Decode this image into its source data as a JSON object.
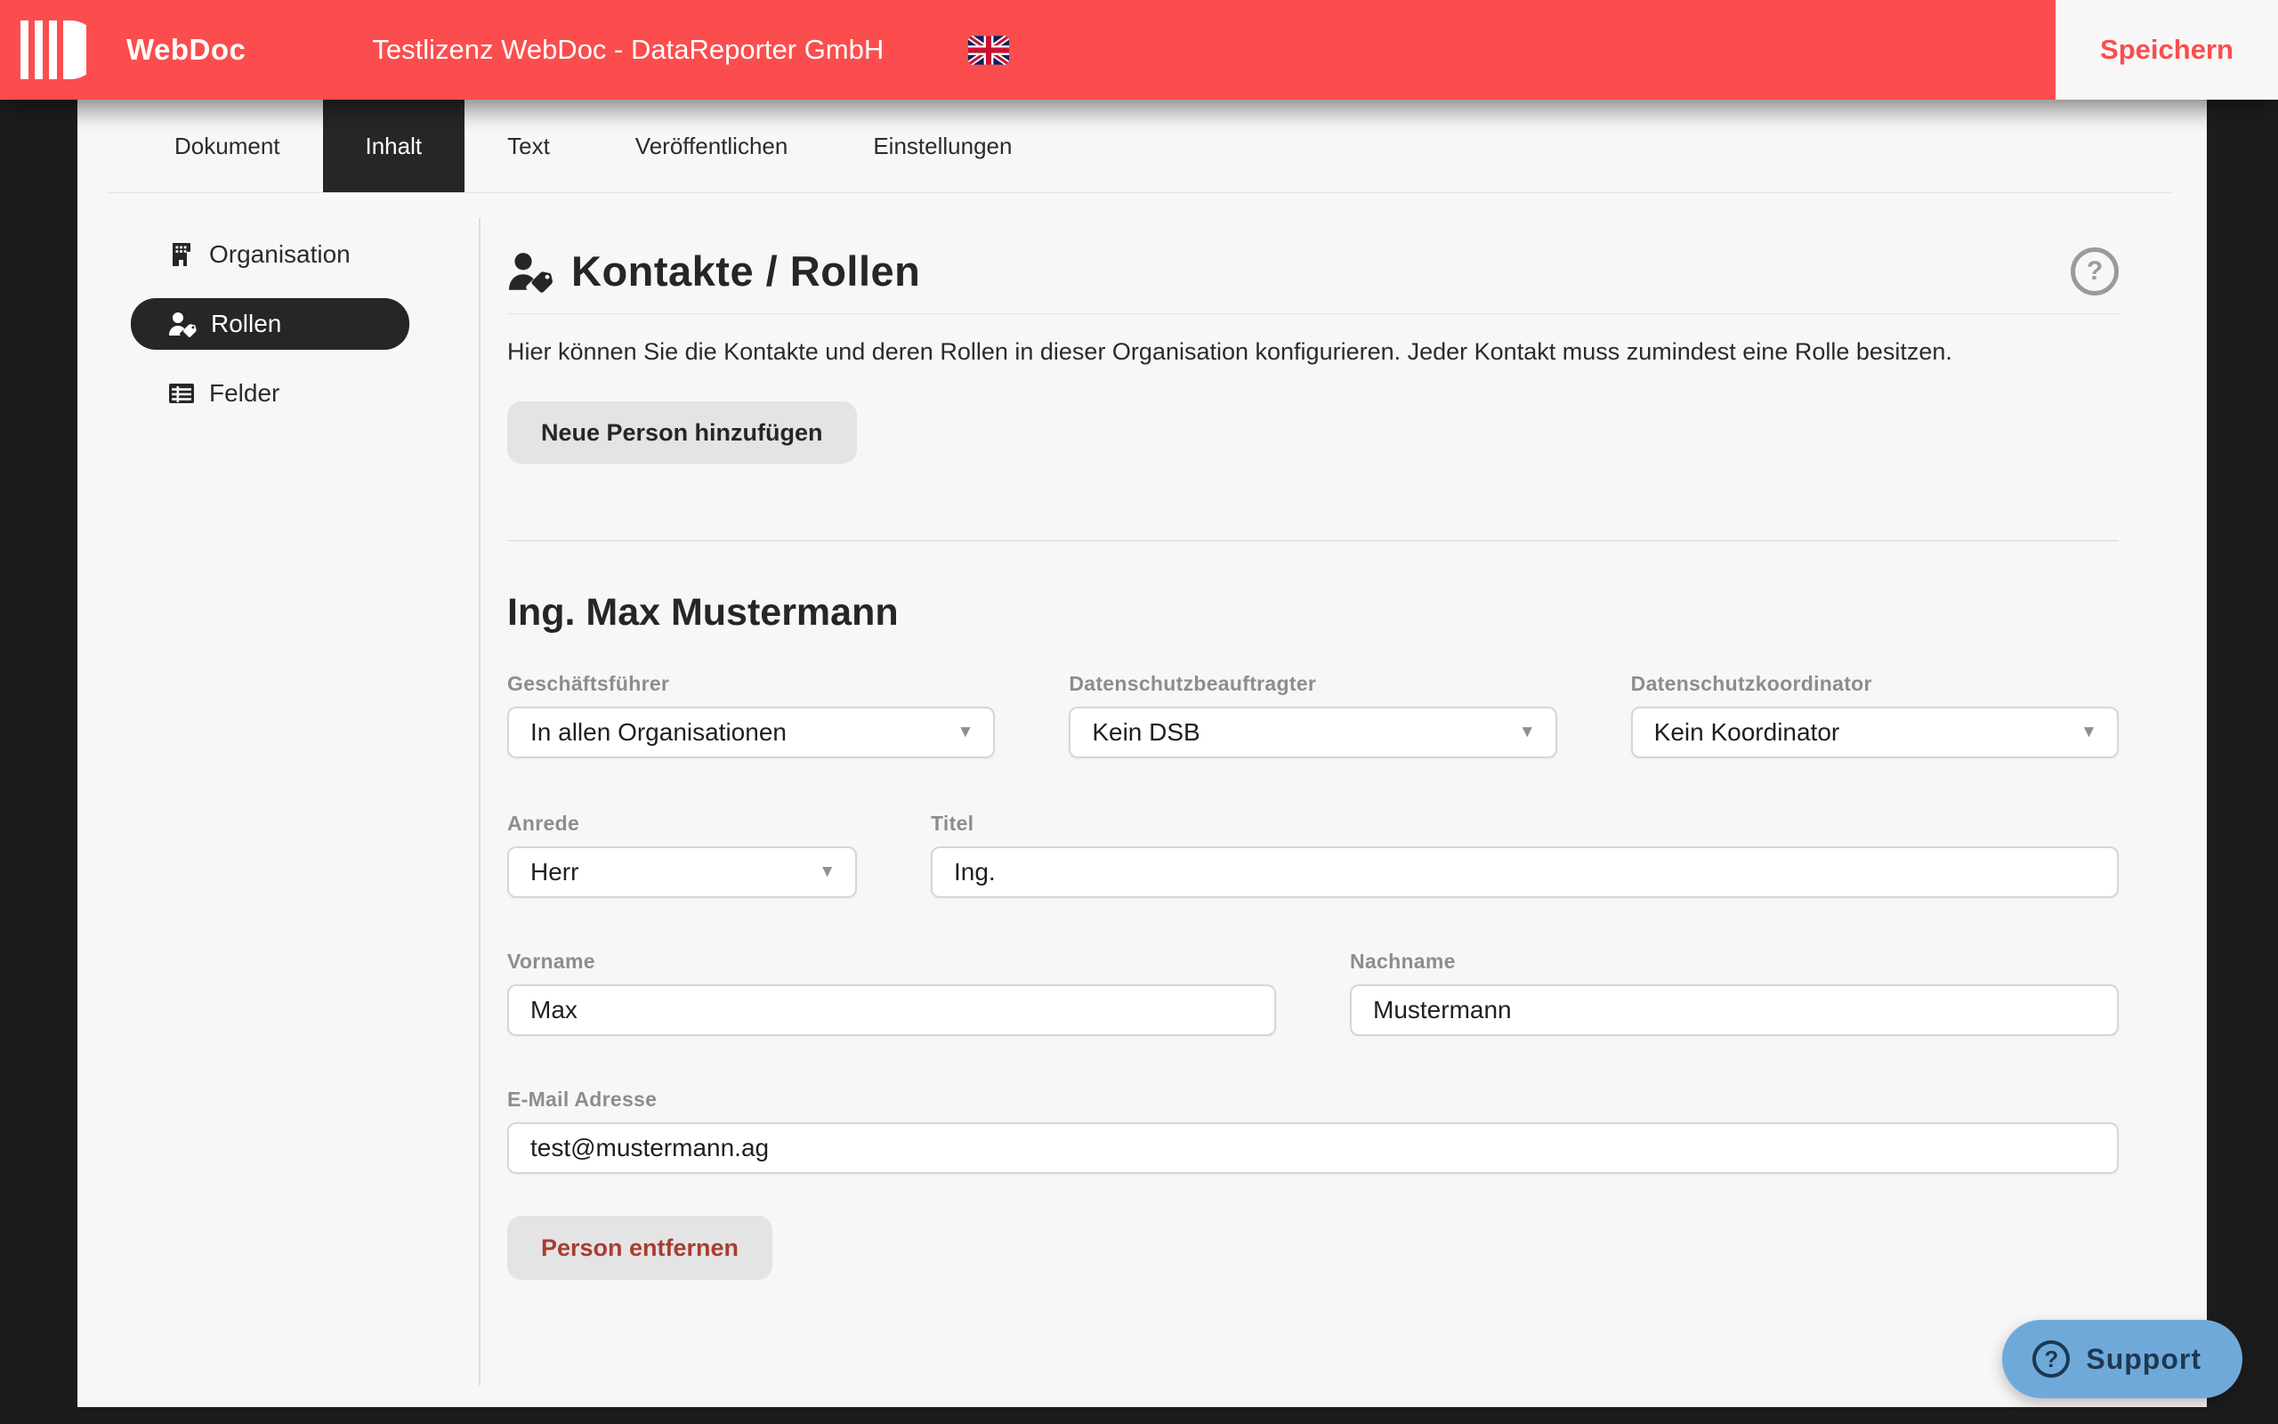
{
  "header": {
    "brand": "WebDoc",
    "title": "Testlizenz WebDoc - DataReporter GmbH",
    "save_label": "Speichern",
    "language_flag": "united-kingdom"
  },
  "tabs": [
    {
      "label": "Dokument",
      "active": false
    },
    {
      "label": "Inhalt",
      "active": true
    },
    {
      "label": "Text",
      "active": false
    },
    {
      "label": "Veröffentlichen",
      "active": false
    },
    {
      "label": "Einstellungen",
      "active": false
    }
  ],
  "sidebar": {
    "items": [
      {
        "label": "Organisation",
        "icon": "building-icon",
        "active": false
      },
      {
        "label": "Rollen",
        "icon": "person-tag-icon",
        "active": true
      },
      {
        "label": "Felder",
        "icon": "table-icon",
        "active": false
      }
    ]
  },
  "main": {
    "heading": "Kontakte / Rollen",
    "heading_icon": "person-tag-icon",
    "help_glyph": "?",
    "description": "Hier können Sie die Kontakte und deren Rollen in dieser Organisation konfigurieren. Jeder Kontakt muss zumindest eine Rolle besitzen.",
    "add_person_button": "Neue Person hinzufügen",
    "person": {
      "name": "Ing. Max Mustermann",
      "geschaeftsfuehrer": {
        "label": "Geschäftsführer",
        "value": "In allen Organisationen"
      },
      "datenschutzbeauftragter": {
        "label": "Datenschutzbeauftragter",
        "value": "Kein DSB"
      },
      "datenschutzkoordinator": {
        "label": "Datenschutzkoordinator",
        "value": "Kein Koordinator"
      },
      "anrede": {
        "label": "Anrede",
        "value": "Herr"
      },
      "titel": {
        "label": "Titel",
        "value": "Ing."
      },
      "vorname": {
        "label": "Vorname",
        "value": "Max"
      },
      "nachname": {
        "label": "Nachname",
        "value": "Mustermann"
      },
      "email": {
        "label": "E-Mail Adresse",
        "value": "test@mustermann.ag"
      }
    },
    "remove_person_button": "Person entfernen"
  },
  "support": {
    "label": "Support",
    "icon_glyph": "?"
  },
  "icons": {
    "select_arrow": "▼"
  },
  "colors": {
    "accent_red": "#fb4d4d",
    "dark_background": "#1c1c1c",
    "panel_background": "#f7f7f7",
    "active_dark": "#262626",
    "support_blue": "#6fa9da",
    "support_navy": "#1d3850",
    "remove_red": "#a93c31",
    "label_gray": "#8d8d8d"
  }
}
